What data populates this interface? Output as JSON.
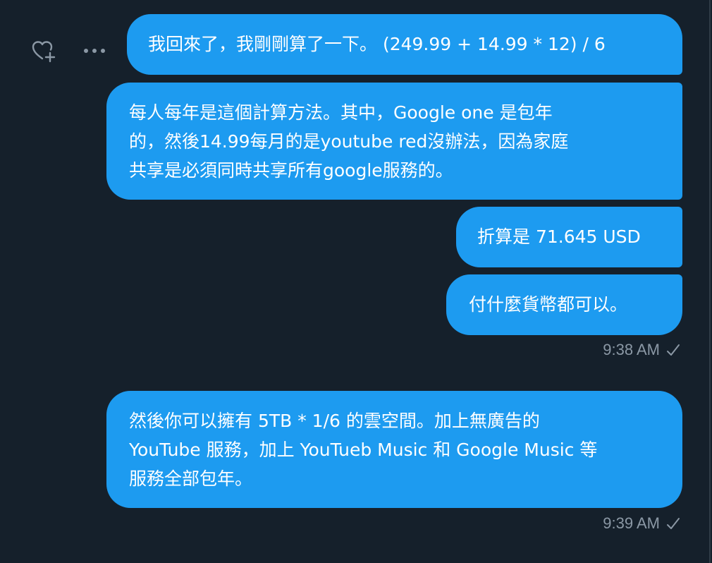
{
  "conversation": {
    "messages": [
      {
        "text": "我回來了，我剛剛算了一下。 (249.99 + 14.99 * 12) / 6"
      },
      {
        "text": "每人每年是這個計算方法。其中，Google one 是包年\n的，然後14.99每月的是youtube  red沒辦法，因為家庭\n共享是必須同時共享所有google服務的。"
      },
      {
        "text": "折算是 71.645 USD"
      },
      {
        "text": "付什麼貨幣都可以。"
      },
      {
        "text": "然後你可以擁有 5TB * 1/6 的雲空間。加上無廣告的\nYouTube 服務，加上 YouTueb Music 和 Google Music 等\n服務全部包年。"
      }
    ],
    "timestamps": [
      "9:38 AM",
      "9:39 AM"
    ]
  },
  "icons": {
    "react": "heart-plus-icon",
    "more": "more-horizontal-icon",
    "sent": "checkmark-icon"
  },
  "colors": {
    "background": "#15202b",
    "bubble": "#1d9bf0",
    "timestamp": "#8b98a5",
    "icon": "#8b98a5"
  }
}
